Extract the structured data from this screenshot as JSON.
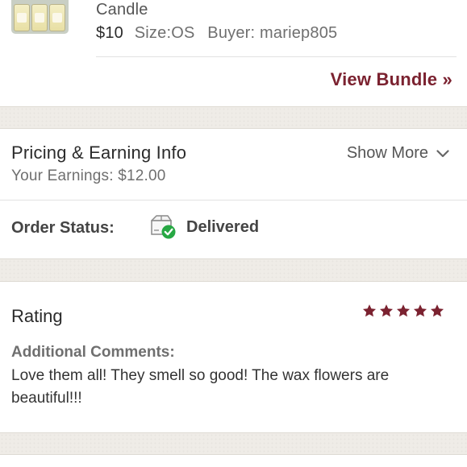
{
  "item": {
    "name_tail": "Candle",
    "price": "$10",
    "size": "Size:OS",
    "buyer": "Buyer: mariep805",
    "view_bundle": "View Bundle »"
  },
  "pricing": {
    "title": "Pricing & Earning Info",
    "earnings": "Your Earnings: $12.00",
    "show_more": "Show More"
  },
  "order_status": {
    "label": "Order Status:",
    "value": "Delivered",
    "icon": "delivered-box-check-icon"
  },
  "rating": {
    "title": "Rating",
    "stars": 5,
    "star_color": "#7b2230",
    "comments_label": "Additional Comments:",
    "comments": "Love them all! They smell so good! The wax flowers are beautiful!!!"
  },
  "colors": {
    "accent": "#7b2230",
    "check_green": "#27a844",
    "divider_band": "#efece7"
  }
}
